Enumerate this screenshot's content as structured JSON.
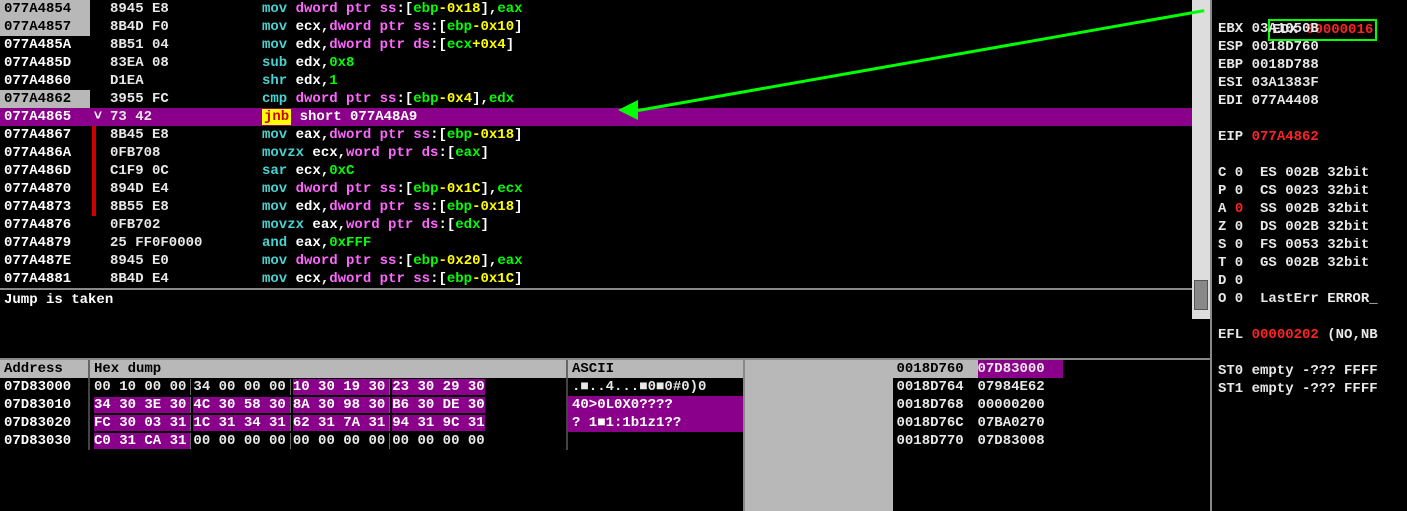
{
  "disasm": [
    {
      "addr": "077A4854",
      "bytes": "8945 E8",
      "asm": "mov dword ptr ss:[ebp-0x18],eax",
      "addrClass": "grey",
      "gut": ""
    },
    {
      "addr": "077A4857",
      "bytes": "8B4D F0",
      "asm": "mov ecx,dword ptr ss:[ebp-0x10]",
      "addrClass": "grey",
      "gut": ""
    },
    {
      "addr": "077A485A",
      "bytes": "8B51 04",
      "asm": "mov edx,dword ptr ds:[ecx+0x4]",
      "addrClass": "",
      "gut": ""
    },
    {
      "addr": "077A485D",
      "bytes": "83EA 08",
      "asm": "sub edx,0x8",
      "addrClass": "",
      "gut": ""
    },
    {
      "addr": "077A4860",
      "bytes": "D1EA",
      "asm": "shr edx,1",
      "addrClass": "",
      "gut": ""
    },
    {
      "addr": "077A4862",
      "bytes": "3955 FC",
      "asm": "cmp dword ptr ss:[ebp-0x4],edx",
      "addrClass": "grey",
      "gut": ""
    },
    {
      "addr": "077A4865",
      "bytes": "73 42",
      "asm": "jnb short 077A48A9",
      "addrClass": "purple",
      "gut": "v",
      "row": "purple"
    },
    {
      "addr": "077A4867",
      "bytes": "8B45 E8",
      "asm": "mov eax,dword ptr ss:[ebp-0x18]",
      "addrClass": "",
      "gut": "r"
    },
    {
      "addr": "077A486A",
      "bytes": "0FB708",
      "asm": "movzx ecx,word ptr ds:[eax]",
      "addrClass": "",
      "gut": "r"
    },
    {
      "addr": "077A486D",
      "bytes": "C1F9 0C",
      "asm": "sar ecx,0xC",
      "addrClass": "",
      "gut": "r"
    },
    {
      "addr": "077A4870",
      "bytes": "894D E4",
      "asm": "mov dword ptr ss:[ebp-0x1C],ecx",
      "addrClass": "",
      "gut": "r"
    },
    {
      "addr": "077A4873",
      "bytes": "8B55 E8",
      "asm": "mov edx,dword ptr ss:[ebp-0x18]",
      "addrClass": "",
      "gut": "r"
    },
    {
      "addr": "077A4876",
      "bytes": "0FB702",
      "asm": "movzx eax,word ptr ds:[edx]",
      "addrClass": "",
      "gut": ""
    },
    {
      "addr": "077A4879",
      "bytes": "25 FF0F0000",
      "asm": "and eax,0xFFF",
      "addrClass": "",
      "gut": ""
    },
    {
      "addr": "077A487E",
      "bytes": "8945 E0",
      "asm": "mov dword ptr ss:[ebp-0x20],eax",
      "addrClass": "",
      "gut": ""
    },
    {
      "addr": "077A4881",
      "bytes": "8B4D E4",
      "asm": "mov ecx,dword ptr ss:[ebp-0x1C]",
      "addrClass": "",
      "gut": ""
    }
  ],
  "status_text": "Jump is taken",
  "hex_header": {
    "addr": "Address",
    "dump": "Hex dump",
    "ascii": "ASCII"
  },
  "hex_rows": [
    {
      "addr": "07D83000",
      "g1": "00 10 00 00",
      "g2": "34 00 00 00",
      "g3": "10 30 19 30",
      "g4": "23 30 29 30",
      "ascii": ".■..4...■0■0#0)0",
      "p": [
        false,
        false,
        true,
        true
      ],
      "pa": false
    },
    {
      "addr": "07D83010",
      "g1": "34 30 3E 30",
      "g2": "4C 30 58 30",
      "g3": "8A 30 98 30",
      "g4": "B6 30 DE 30",
      "ascii": "40>0L0X0????",
      "p": [
        true,
        true,
        true,
        true
      ],
      "pa": true
    },
    {
      "addr": "07D83020",
      "g1": "FC 30 03 31",
      "g2": "1C 31 34 31",
      "g3": "62 31 7A 31",
      "g4": "94 31 9C 31",
      "ascii": "? 1■1:1b1z1??",
      "p": [
        true,
        true,
        true,
        true
      ],
      "pa": true
    },
    {
      "addr": "07D83030",
      "g1": "C0 31 CA 31",
      "g2": "00 00 00 00",
      "g3": "00 00 00 00",
      "g4": "00 00 00 00",
      "ascii": "",
      "p": [
        true,
        false,
        false,
        false
      ],
      "pa": false
    }
  ],
  "stack": [
    {
      "addr": "0018D760",
      "val": "07D83000",
      "hl": true
    },
    {
      "addr": "0018D764",
      "val": "07984E62",
      "hl": false
    },
    {
      "addr": "0018D768",
      "val": "00000200",
      "hl": false
    },
    {
      "addr": "0018D76C",
      "val": "07BA0270",
      "hl": false
    },
    {
      "addr": "0018D770",
      "val": "07D83008",
      "hl": false
    }
  ],
  "regs": {
    "edx_name": "EDX",
    "edx_val": "00000016",
    "ebx_name": "EBX",
    "ebx_val": "03A1050B",
    "esp_name": "ESP",
    "esp_val": "0018D760",
    "ebp_name": "EBP",
    "ebp_val": "0018D788",
    "esi_name": "ESI",
    "esi_val": "03A1383F",
    "edi_name": "EDI",
    "edi_val": "077A4408",
    "eip_name": "EIP",
    "eip_val": "077A4862",
    "flags": [
      "C 0  ES 002B 32bit",
      "P 0  CS 0023 32bit",
      "A 0  SS 002B 32bit",
      "Z 0  DS 002B 32bit",
      "S 0  FS 0053 32bit",
      "T 0  GS 002B 32bit",
      "D 0",
      "O 0  LastErr ERROR_"
    ],
    "flags_a_red": "0",
    "efl_name": "EFL",
    "efl_val": "00000202",
    "efl_tail": " (NO,NB",
    "st0": "ST0 empty -??? FFFF",
    "st1": "ST1 empty -??? FFFF"
  }
}
